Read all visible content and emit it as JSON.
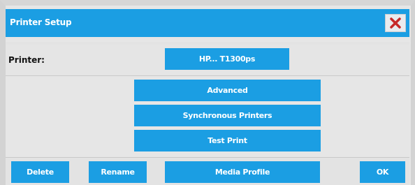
{
  "dialog": {
    "title": "Printer Setup",
    "close_icon": "close-icon",
    "accent_color": "#1b9ee3"
  },
  "printer": {
    "label": "Printer:",
    "selected": "HP... T1300ps"
  },
  "actions": {
    "advanced": "Advanced",
    "synchronous_printers": "Synchronous Printers",
    "test_print": "Test Print"
  },
  "footer": {
    "delete": "Delete",
    "rename": "Rename",
    "media_profile": "Media Profile",
    "ok": "OK"
  }
}
